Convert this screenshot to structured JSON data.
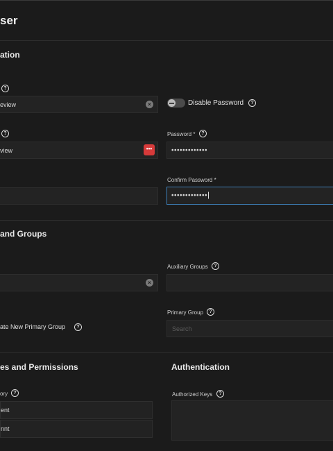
{
  "page": {
    "title": "ser"
  },
  "sections": {
    "identification": {
      "title": "ation"
    },
    "groups": {
      "title": "and Groups"
    },
    "directories": {
      "title": "es and Permissions"
    },
    "authentication": {
      "title": "Authentication"
    }
  },
  "fields": {
    "full_name": {
      "value": "eview"
    },
    "username": {
      "value": "view"
    },
    "disable_password": {
      "label": "Disable Password",
      "enabled": false
    },
    "password": {
      "label": "Password *",
      "value": "•••••••••••••"
    },
    "confirm_password": {
      "label": "Confirm Password *",
      "value": "•••••••••••••"
    },
    "auxiliary_groups": {
      "label": "Auxiliary Groups"
    },
    "create_primary_group": {
      "label": "ate New Primary Group"
    },
    "primary_group": {
      "label": "Primary Group",
      "placeholder": "Search"
    },
    "home_directory": {
      "label": "ory",
      "rows": [
        "ent",
        "nnt"
      ]
    },
    "authorized_keys": {
      "label": "Authorized Keys"
    }
  },
  "icons": {
    "help": "?",
    "clear": "×",
    "password_manager": "•••"
  },
  "colors": {
    "background": "#1b1b1b",
    "field": "#232323",
    "focus": "#3e7fb8",
    "password_manager": "#d63a3a"
  }
}
